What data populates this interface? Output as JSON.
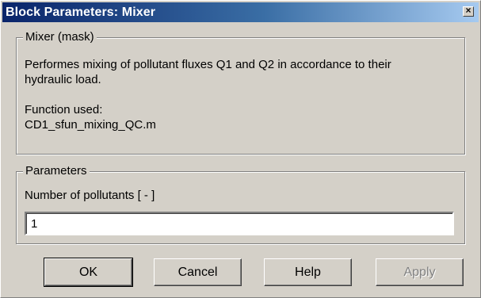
{
  "window": {
    "title": "Block Parameters: Mixer",
    "close_glyph": "×"
  },
  "description_group": {
    "title": "Mixer (mask)",
    "line1": "Performes mixing of pollutant fluxes Q1 and Q2 in accordance to their",
    "line2": "hydraulic load.",
    "line3": "Function used:",
    "line4": "CD1_sfun_mixing_QC.m"
  },
  "parameters_group": {
    "title": "Parameters",
    "label": "Number of pollutants [ - ]",
    "value": "1"
  },
  "buttons": {
    "ok": "OK",
    "cancel": "Cancel",
    "help": "Help",
    "apply": "Apply"
  },
  "colors": {
    "titlebar_start": "#0a246a",
    "titlebar_end": "#a6caf0",
    "face": "#d4d0c8"
  }
}
